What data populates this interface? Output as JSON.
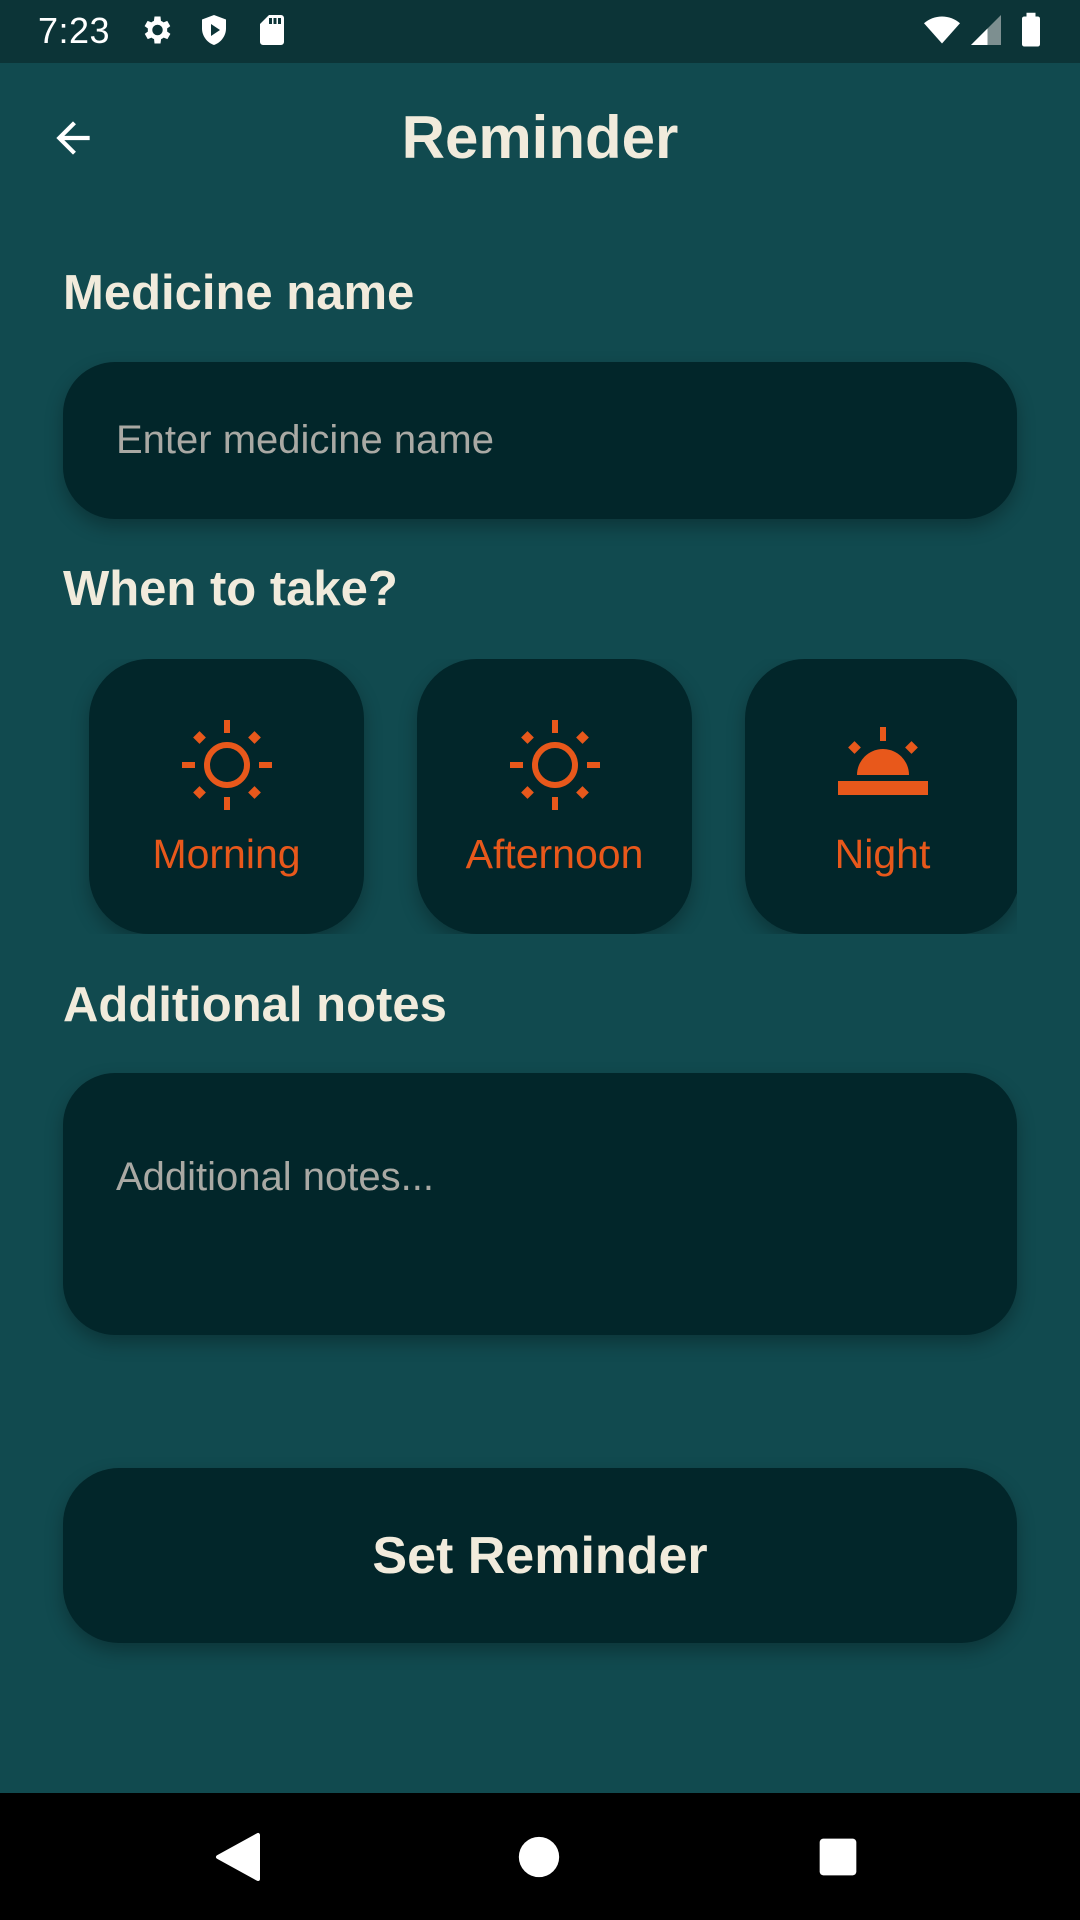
{
  "status_bar": {
    "time": "7:23",
    "icons": [
      "gear-icon",
      "shield-icon",
      "sd-card-icon",
      "wifi-icon",
      "signal-icon",
      "battery-icon"
    ]
  },
  "app_bar": {
    "title": "Reminder",
    "back_icon": "arrow-back-icon"
  },
  "medicine": {
    "label": "Medicine name",
    "placeholder": "Enter medicine name",
    "value": ""
  },
  "when": {
    "label": "When to take?",
    "options": [
      {
        "label": "Morning",
        "icon": "sun-icon"
      },
      {
        "label": "Afternoon",
        "icon": "sun-icon"
      },
      {
        "label": "Night",
        "icon": "sunset-icon"
      }
    ]
  },
  "notes": {
    "label": "Additional notes",
    "placeholder": "Additional notes...",
    "value": ""
  },
  "submit": {
    "label": "Set Reminder"
  },
  "nav": {
    "back": "nav-back-icon",
    "home": "nav-home-icon",
    "recents": "nav-recents-icon"
  },
  "colors": {
    "background": "#114a4f",
    "status_bar": "#0c3437",
    "card": "#02262a",
    "accent": "#e8581b",
    "text": "#f1ebdc",
    "placeholder": "#a9a9a4"
  }
}
